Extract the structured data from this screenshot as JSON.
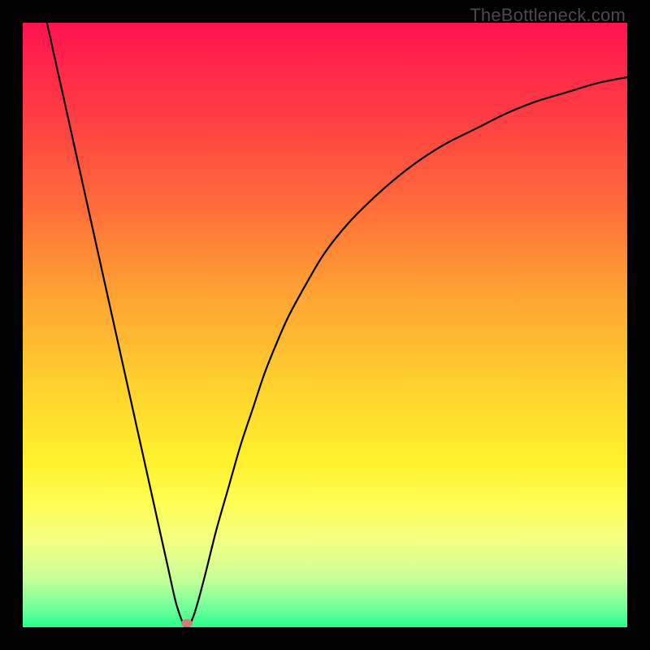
{
  "watermark": "TheBottleneck.com",
  "chart_data": {
    "type": "line",
    "title": "",
    "xlabel": "",
    "ylabel": "",
    "xlim": [
      0,
      100
    ],
    "ylim": [
      0,
      100
    ],
    "gradient_stops": [
      {
        "offset": 0,
        "color": "#ff134f"
      },
      {
        "offset": 0.17,
        "color": "#ff4242"
      },
      {
        "offset": 0.3,
        "color": "#ff6b3a"
      },
      {
        "offset": 0.45,
        "color": "#ffa333"
      },
      {
        "offset": 0.6,
        "color": "#ffd12e"
      },
      {
        "offset": 0.73,
        "color": "#fff22d"
      },
      {
        "offset": 0.8,
        "color": "#feff58"
      },
      {
        "offset": 0.86,
        "color": "#f3ff85"
      },
      {
        "offset": 0.92,
        "color": "#c7ff97"
      },
      {
        "offset": 0.97,
        "color": "#6fff9a"
      },
      {
        "offset": 1.0,
        "color": "#22ff8e"
      }
    ],
    "series": [
      {
        "name": "bottleneck-curve",
        "color": "#000000",
        "x": [
          4,
          6,
          8,
          10,
          12,
          14,
          16,
          18,
          20,
          22,
          24,
          25.5,
          27,
          28.3,
          30,
          32,
          34,
          36,
          38,
          40,
          42,
          44,
          47,
          50,
          54,
          58,
          62,
          66,
          70,
          75,
          80,
          85,
          90,
          95,
          100
        ],
        "y": [
          100,
          91,
          82,
          73,
          64,
          55,
          46,
          37,
          28,
          19,
          10,
          3.5,
          0,
          2,
          8,
          16,
          23,
          30,
          36,
          42,
          47,
          51.5,
          57,
          62,
          67,
          71,
          74.5,
          77.5,
          80,
          82.5,
          85,
          87,
          88.5,
          90,
          91
        ]
      }
    ],
    "marker": {
      "x": 27.2,
      "y": 0.7,
      "color": "#d37a7a"
    }
  }
}
